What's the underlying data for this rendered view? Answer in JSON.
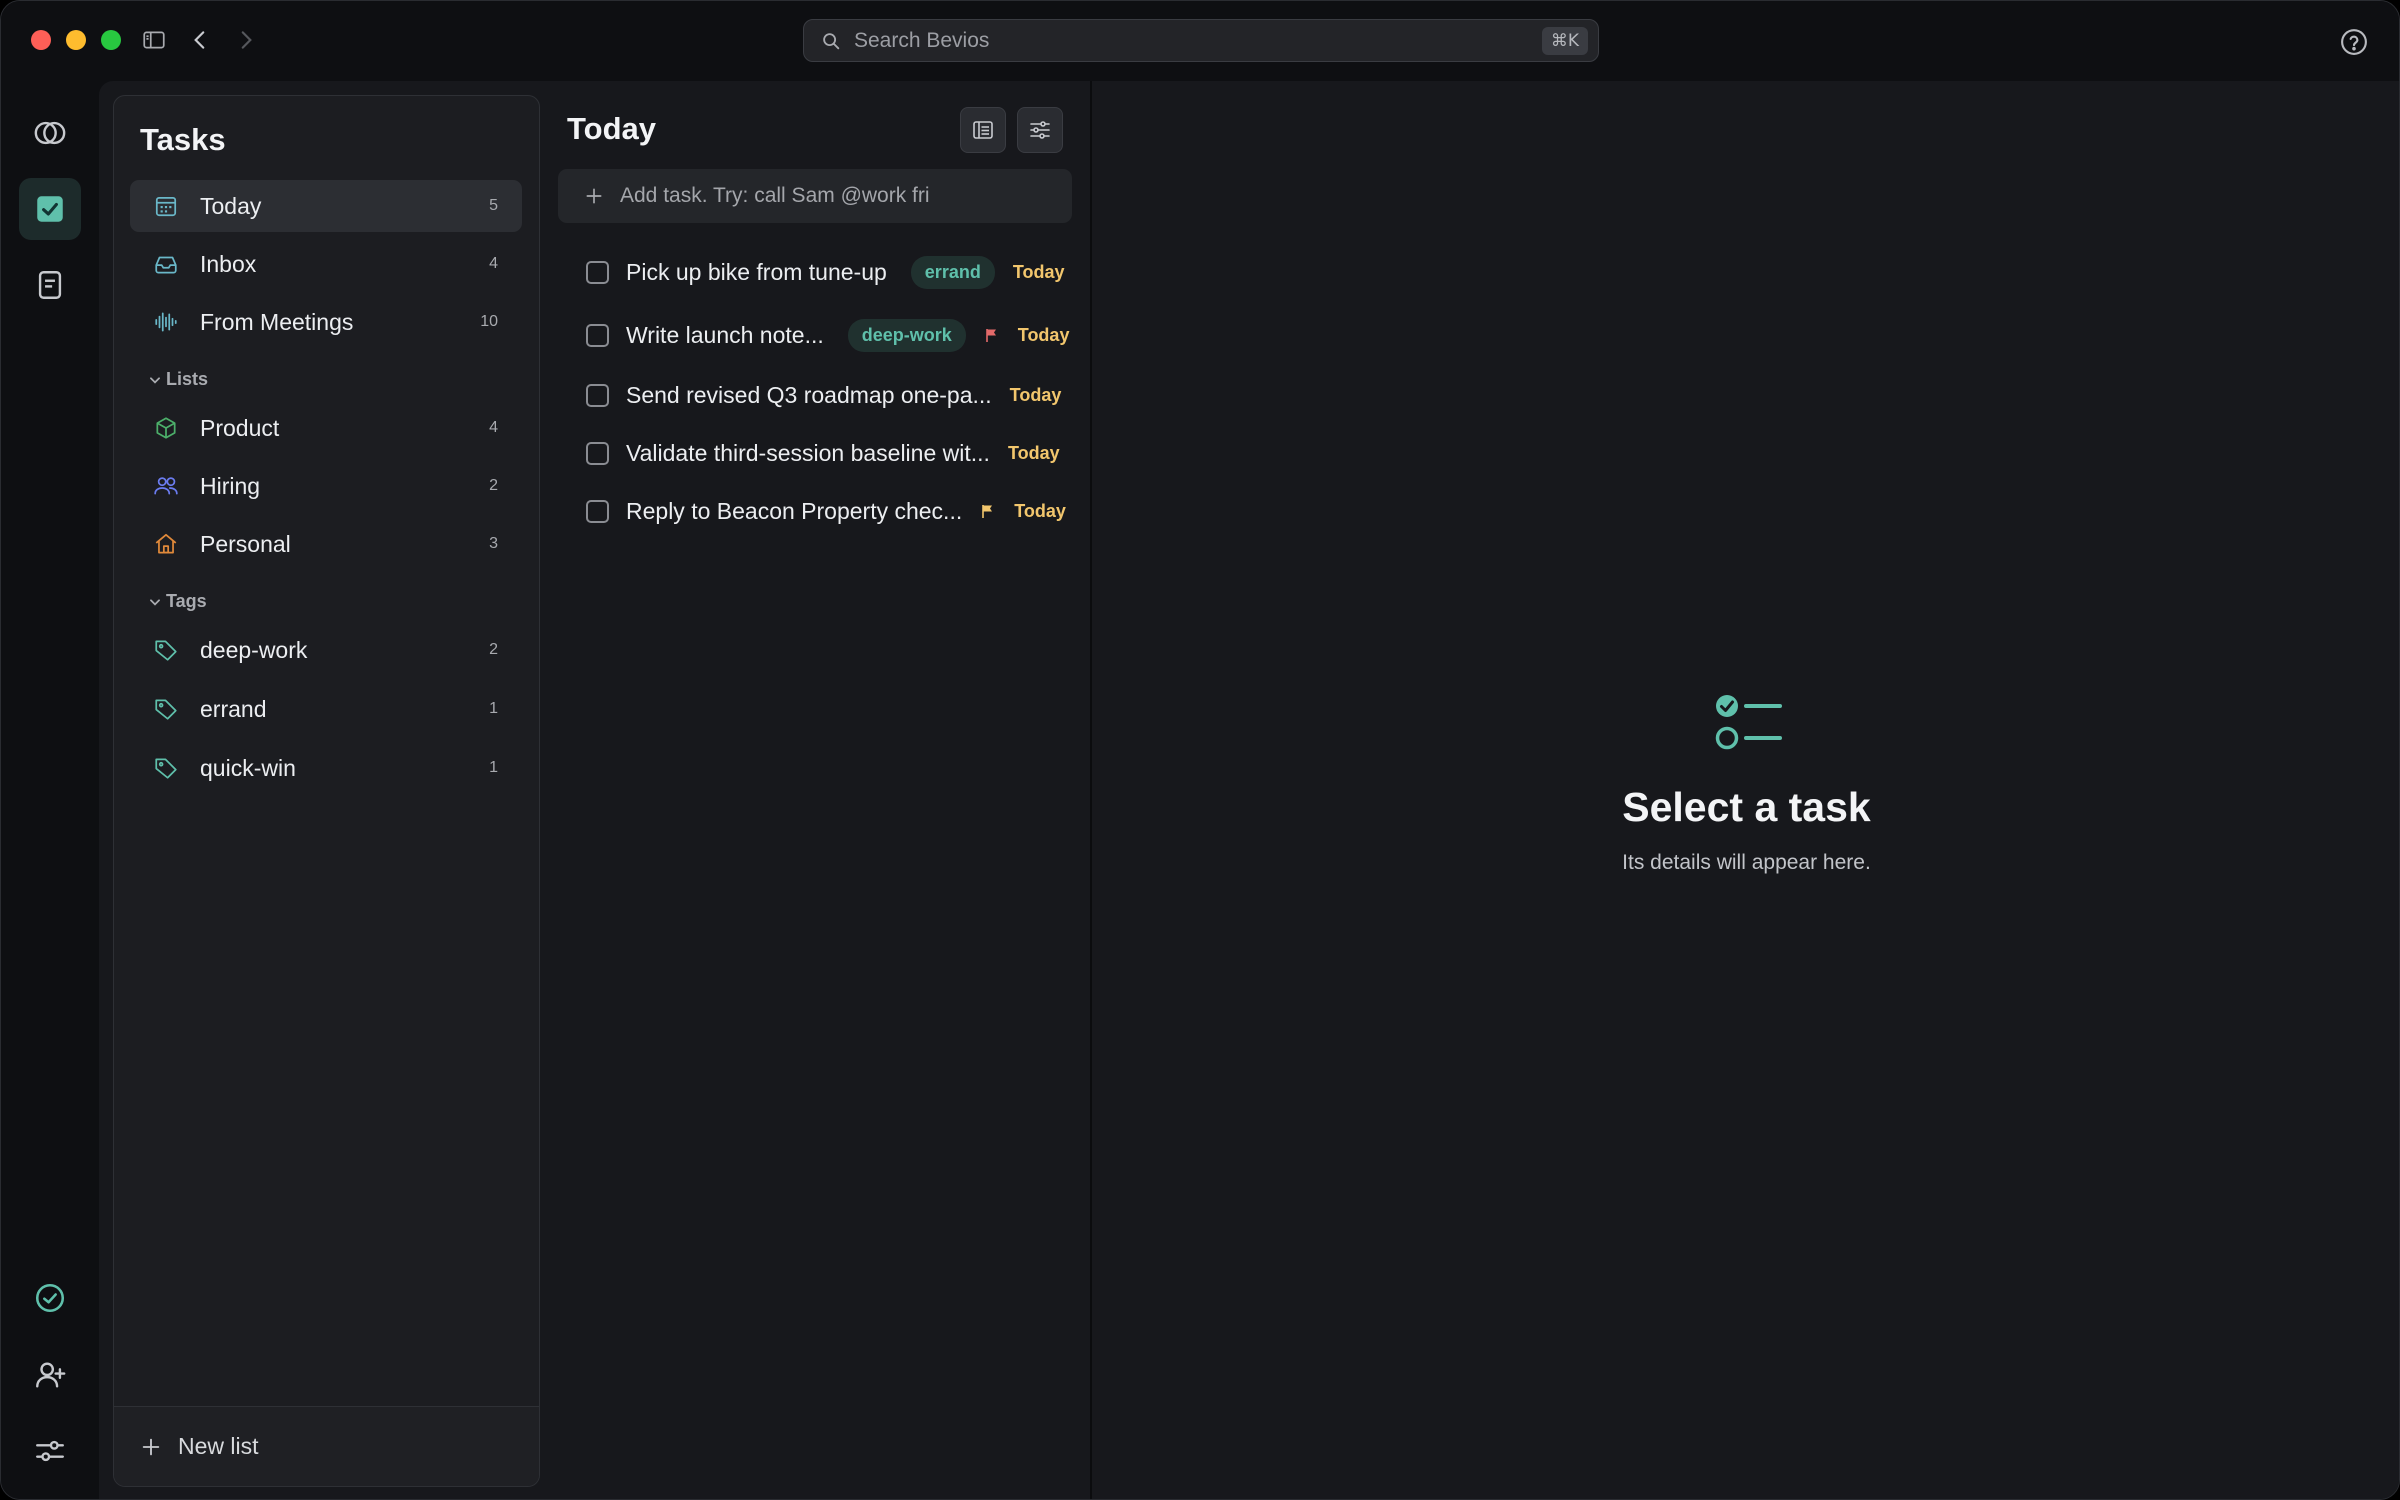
{
  "search": {
    "placeholder": "Search Bevios",
    "shortcut": "⌘K"
  },
  "rail": {
    "items": [
      {
        "icon": "overlap-circles-icon",
        "active": false
      },
      {
        "icon": "checkbox-icon",
        "active": true
      },
      {
        "icon": "notes-icon",
        "active": false
      }
    ],
    "bottom": [
      {
        "icon": "check-circle-icon"
      },
      {
        "icon": "add-user-icon"
      },
      {
        "icon": "sliders-icon"
      }
    ]
  },
  "sidebar": {
    "title": "Tasks",
    "smart": [
      {
        "label": "Today",
        "count": "5",
        "icon": "calendar-icon",
        "active": true
      },
      {
        "label": "Inbox",
        "count": "4",
        "icon": "inbox-icon"
      },
      {
        "label": "From Meetings",
        "count": "10",
        "icon": "waveform-icon"
      }
    ],
    "lists_heading": "Lists",
    "lists": [
      {
        "label": "Product",
        "count": "4",
        "icon": "box-icon",
        "color": "#4caf6a"
      },
      {
        "label": "Hiring",
        "count": "2",
        "icon": "people-icon",
        "color": "#6b7cf0"
      },
      {
        "label": "Personal",
        "count": "3",
        "icon": "home-icon",
        "color": "#e0893a"
      }
    ],
    "tags_heading": "Tags",
    "tags": [
      {
        "label": "deep-work",
        "count": "2",
        "icon": "tag-icon"
      },
      {
        "label": "errand",
        "count": "1",
        "icon": "tag-icon"
      },
      {
        "label": "quick-win",
        "count": "1",
        "icon": "tag-icon"
      }
    ],
    "new_list": "New list"
  },
  "tasks": {
    "title": "Today",
    "add_placeholder": "Add task. Try: call Sam @work fri",
    "items": [
      {
        "title": "Pick up bike from tune-up",
        "tag": "errand",
        "flag": "",
        "due": "Today"
      },
      {
        "title": "Write launch note...",
        "tag": "deep-work",
        "flag": "#e36a6a",
        "due": "Today"
      },
      {
        "title": "Send revised Q3 roadmap one-pa...",
        "tag": "",
        "flag": "",
        "due": "Today"
      },
      {
        "title": "Validate third-session baseline wit...",
        "tag": "",
        "flag": "",
        "due": "Today"
      },
      {
        "title": "Reply to Beacon Property chec...",
        "tag": "",
        "flag": "#f2c66d",
        "due": "Today"
      }
    ]
  },
  "detail": {
    "empty_title": "Select a task",
    "empty_subtitle": "Its details will appear here."
  },
  "colors": {
    "accent": "#5fc0ab",
    "due": "#f2c66d"
  }
}
